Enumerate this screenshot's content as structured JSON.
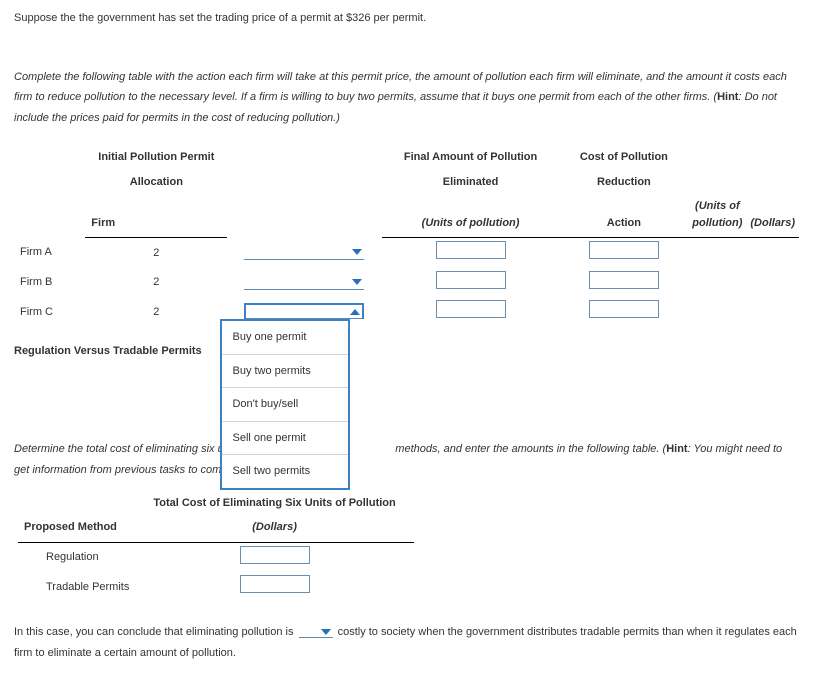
{
  "intro": "Suppose the the government has set the trading price of a permit at $326 per permit.",
  "instructions_1": "Complete the following table with the action each firm will take at this permit price, the amount of pollution each firm will eliminate, and the amount it costs each firm to reduce pollution to the necessary level. If a firm is willing to buy two permits, assume that it buys one permit from each of the other firms. (",
  "hint_label": "Hint",
  "instructions_2": ": Do not include the prices paid for permits in the cost of reducing pollution.)",
  "table": {
    "col_firm": "Firm",
    "col_alloc_1": "Initial Pollution Permit",
    "col_alloc_2": "Allocation",
    "col_alloc_3": "(Units of pollution)",
    "col_action": "Action",
    "col_elim_1": "Final Amount of Pollution",
    "col_elim_2": "Eliminated",
    "col_elim_3": "(Units of pollution)",
    "col_cost_1": "Cost of Pollution",
    "col_cost_2": "Reduction",
    "col_cost_3": "(Dollars)",
    "rows": [
      {
        "firm": "Firm A",
        "alloc": "2"
      },
      {
        "firm": "Firm B",
        "alloc": "2"
      },
      {
        "firm": "Firm C",
        "alloc": "2"
      }
    ]
  },
  "dropdown_options": [
    "Buy one permit",
    "Buy two permits",
    "Don't buy/sell",
    "Sell one permit",
    "Sell two permits"
  ],
  "section_title": "Regulation Versus Tradable Permits",
  "para2_a": "Determine the total cost of eliminating six units of p",
  "para2_b": "methods, and enter the amounts in the following table. (",
  "para2_c": ": You might need to get information from previous tasks to complete",
  "cost_table": {
    "title": "Total Cost of Eliminating Six Units of Pollution",
    "col_method": "Proposed Method",
    "col_dollars": "(Dollars)",
    "rows": [
      "Regulation",
      "Tradable Permits"
    ]
  },
  "conclusion_a": "In this case, you can conclude that eliminating pollution is",
  "conclusion_b": "costly to society when the government distributes tradable permits than when it regulates each firm to eliminate a certain amount of pollution."
}
